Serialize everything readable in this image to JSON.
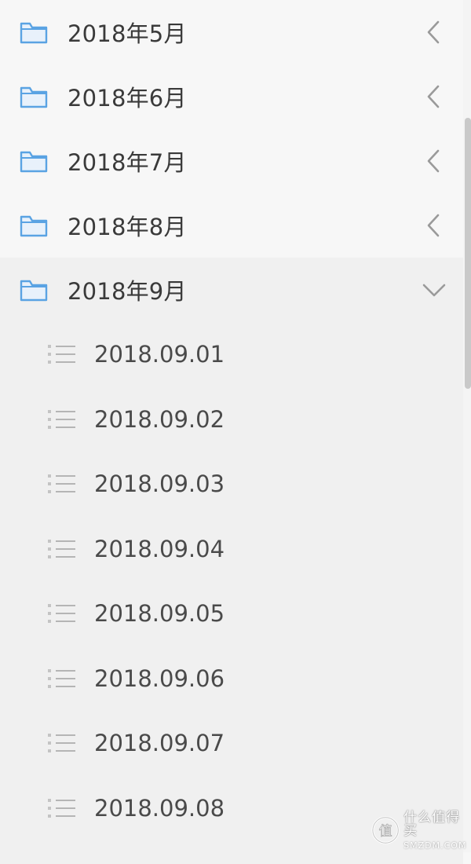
{
  "colors": {
    "folder_icon": "#5aa3e3",
    "chevron": "#9a9a9a",
    "list_icon": "#b5b5b5",
    "text": "#3a3a3a"
  },
  "folders": [
    {
      "label": "2018年5月",
      "icon": "folder-icon",
      "chevron": "chevron-left-icon",
      "expanded": false
    },
    {
      "label": "2018年6月",
      "icon": "folder-icon",
      "chevron": "chevron-left-icon",
      "expanded": false
    },
    {
      "label": "2018年7月",
      "icon": "folder-icon",
      "chevron": "chevron-left-icon",
      "expanded": false
    },
    {
      "label": "2018年8月",
      "icon": "folder-icon",
      "chevron": "chevron-left-icon",
      "expanded": false
    },
    {
      "label": "2018年9月",
      "icon": "folder-icon",
      "chevron": "chevron-down-icon",
      "expanded": true,
      "children": [
        {
          "label": "2018.09.01",
          "icon": "list-icon"
        },
        {
          "label": "2018.09.02",
          "icon": "list-icon"
        },
        {
          "label": "2018.09.03",
          "icon": "list-icon"
        },
        {
          "label": "2018.09.04",
          "icon": "list-icon"
        },
        {
          "label": "2018.09.05",
          "icon": "list-icon"
        },
        {
          "label": "2018.09.06",
          "icon": "list-icon"
        },
        {
          "label": "2018.09.07",
          "icon": "list-icon"
        },
        {
          "label": "2018.09.08",
          "icon": "list-icon"
        }
      ]
    }
  ],
  "watermark": {
    "main": "什么值得买",
    "sub": "SMZDM.COM",
    "logo_char": "值"
  }
}
